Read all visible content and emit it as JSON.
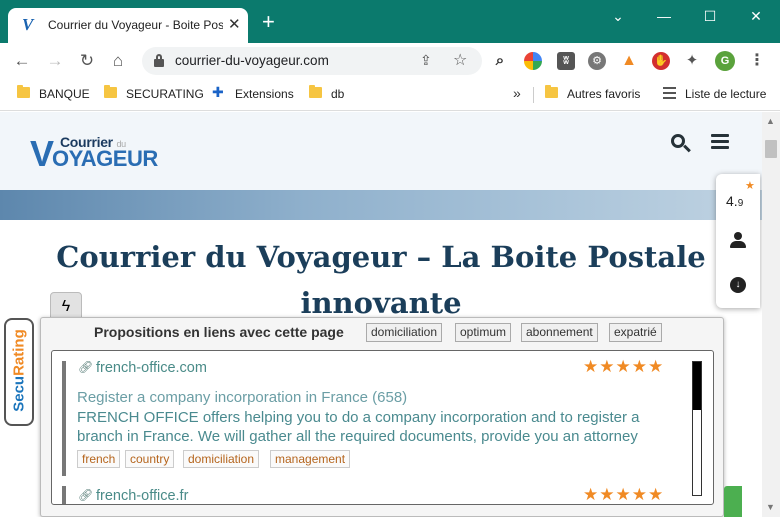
{
  "browser": {
    "tab_title": "Courrier du Voyageur - Boite Postale",
    "tab_favicon_letter": "V",
    "url": "courrier-du-voyageur.com",
    "profile_initial": "G",
    "accent_color": "#0b7a6d"
  },
  "bookmarks": [
    {
      "label": "BANQUE",
      "icon": "folder-icon"
    },
    {
      "label": "SECURATING",
      "icon": "folder-icon"
    },
    {
      "label": "Extensions",
      "icon": "puzzle-icon"
    },
    {
      "label": "db",
      "icon": "folder-icon"
    }
  ],
  "bookmarks_right": {
    "other_label": "Autres favoris",
    "reading_list_label": "Liste de lecture"
  },
  "site": {
    "logo_top": "Courrier",
    "logo_du": "du",
    "logo_v": "V",
    "logo_rest": "OYAGEUR",
    "page_title": "Courrier du Voyageur – La Boite Postale innovante"
  },
  "rating_widget": {
    "score_main": "4.",
    "score_decimal": "9"
  },
  "securating_tab": {
    "label_a": "Secu",
    "label_b": "Rating"
  },
  "related_panel": {
    "heading": "Propositions en liens avec cette page",
    "keywords": [
      "domiciliation",
      "optimum",
      "abonnement",
      "expatrié"
    ],
    "results": [
      {
        "link": "french-office.com",
        "stars": "★★★★★",
        "title": "Register a company incorporation in France (658)",
        "description": "FRENCH OFFICE offers helping you to do a company incorporation and to register a branch in France. We will gather all the required documents, provide you an attorney",
        "tags": [
          "french",
          "country",
          "domiciliation",
          "management"
        ]
      },
      {
        "link": "french-office.fr",
        "stars": "★★★★★"
      }
    ]
  },
  "colors": {
    "star_orange": "#f08a24",
    "link_teal": "#4a8b88",
    "title_navy": "#1b3e5a",
    "tag_brown": "#b5651d"
  }
}
